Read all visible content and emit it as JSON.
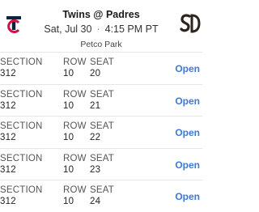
{
  "header": {
    "title": "Twins @ Padres",
    "date": "Sat, Jul 30",
    "time": "4:15 PM PT",
    "venue": "Petco Park",
    "away_logo_icon": "twins-tc-logo-icon",
    "home_logo_icon": "padres-sd-logo-icon"
  },
  "labels": {
    "section": "SECTION",
    "row": "ROW",
    "seat": "SEAT"
  },
  "tickets": [
    {
      "section": "312",
      "row": "10",
      "seat": "20",
      "action": "Open"
    },
    {
      "section": "312",
      "row": "10",
      "seat": "21",
      "action": "Open"
    },
    {
      "section": "312",
      "row": "10",
      "seat": "22",
      "action": "Open"
    },
    {
      "section": "312",
      "row": "10",
      "seat": "23",
      "action": "Open"
    },
    {
      "section": "312",
      "row": "10",
      "seat": "24",
      "action": "Open"
    }
  ],
  "colors": {
    "accent": "#3a7ad9",
    "twins_navy": "#0c2340",
    "twins_red": "#d31145",
    "padres_brown": "#2f241d"
  }
}
